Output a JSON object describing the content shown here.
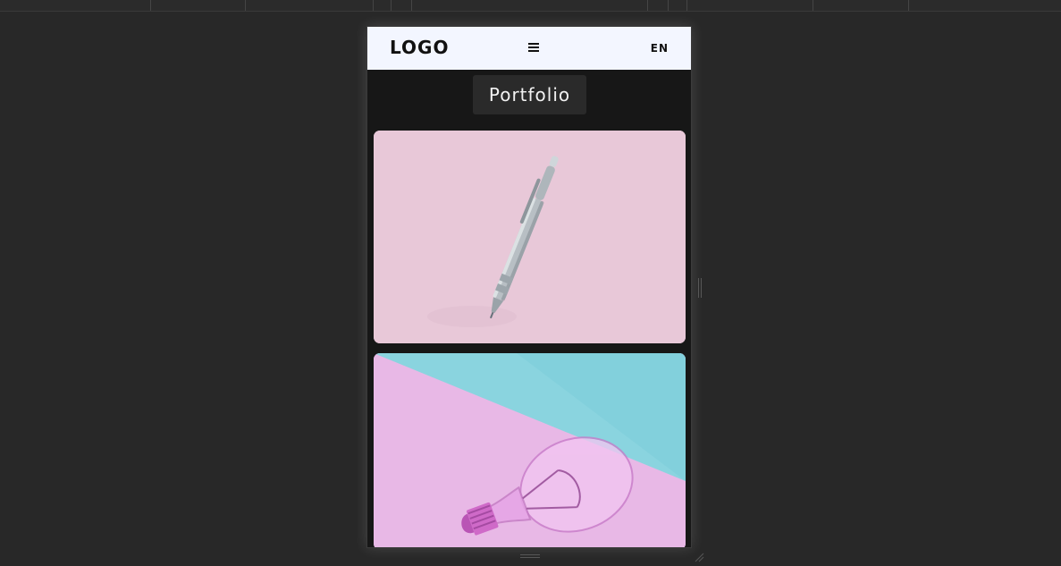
{
  "header": {
    "logo": "LOGO",
    "menu_icon": "hamburger-menu-icon",
    "language": "EN"
  },
  "page": {
    "title": "Portfolio"
  },
  "portfolio": {
    "items": [
      {
        "image": "pen-on-pink-background"
      },
      {
        "image": "lightbulb-on-pink-and-teal-background"
      }
    ]
  },
  "colors": {
    "workspace_bg": "#282828",
    "viewport_bg": "#171717",
    "header_bg": "#f3f6ff",
    "title_bg": "#2a2a2a",
    "text_dark": "#111111",
    "text_light": "#f2f2f2",
    "card1_bg": "#e8c8d8",
    "card2_pink": "#e8b8e6",
    "card2_teal": "#8ad4df"
  }
}
